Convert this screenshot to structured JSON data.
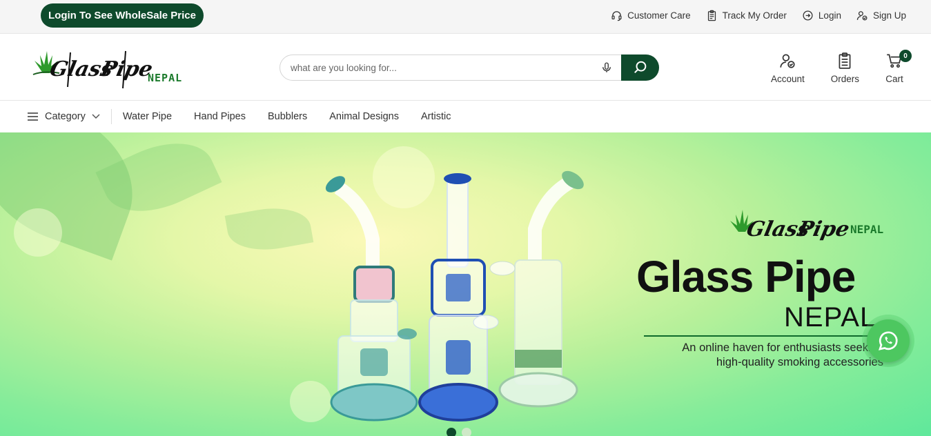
{
  "topbar": {
    "wholesale_label": "Login To See WholeSale Price",
    "links": [
      {
        "label": "Customer Care",
        "icon": "headset-icon"
      },
      {
        "label": "Track My Order",
        "icon": "clipboard-icon"
      },
      {
        "label": "Login",
        "icon": "login-icon"
      },
      {
        "label": "Sign Up",
        "icon": "user-plus-icon"
      }
    ]
  },
  "header": {
    "logo_text": "NEPAL",
    "search_placeholder": "what are you looking for...",
    "actions": [
      {
        "label": "Account",
        "icon": "account-icon"
      },
      {
        "label": "Orders",
        "icon": "orders-icon"
      },
      {
        "label": "Cart",
        "icon": "cart-icon",
        "count": "0"
      }
    ]
  },
  "nav": {
    "category_label": "Category",
    "items": [
      "Water Pipe",
      "Hand Pipes",
      "Bubblers",
      "Animal Designs",
      "Artistic"
    ]
  },
  "hero": {
    "logo_text": "NEPAL",
    "title": "Glass Pipe",
    "subtitle": "NEPAL",
    "tagline_1": "An online haven for enthusiasts seeking",
    "tagline_2": "high-quality smoking accessories",
    "slides": 2,
    "active_slide": 1
  },
  "colors": {
    "brand": "#0e4a2c",
    "logo_green": "#1b7a2c",
    "whatsapp": "#4dc760"
  }
}
